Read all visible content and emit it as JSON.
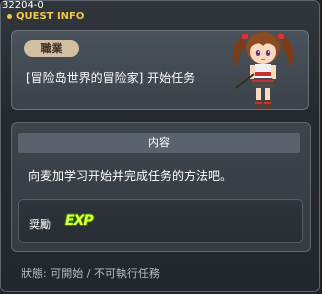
{
  "window": {
    "quest_id": "32204-0",
    "title": "QUEST INFO"
  },
  "header": {
    "job_badge": "職業",
    "quest_title": "[冒险岛世界的冒险家] 开始任务"
  },
  "content": {
    "header": "内容",
    "text": "向麦加学习开始并完成任务的方法吧。"
  },
  "reward": {
    "label": "奨勵",
    "icon": "exp-icon",
    "icon_text": "EXP"
  },
  "status": {
    "text": "狀態: 可開始 / 不可執行任務"
  },
  "colors": {
    "accent": "#f3c74a",
    "exp": "#eaff3c",
    "badge": "#d2bea2"
  }
}
